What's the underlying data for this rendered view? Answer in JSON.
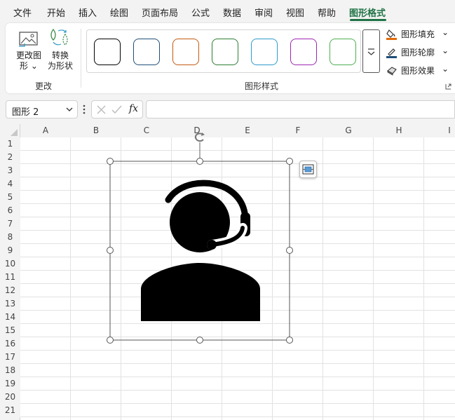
{
  "menu": {
    "items": [
      "文件",
      "开始",
      "插入",
      "绘图",
      "页面布局",
      "公式",
      "数据",
      "审阅",
      "视图",
      "帮助",
      "图形格式"
    ],
    "active_index": 10,
    "accent": "#217346"
  },
  "ribbon": {
    "change_group": {
      "label": "更改",
      "change_graphic_line1": "更改图",
      "change_graphic_line2": "形",
      "convert_line1": "转换",
      "convert_line2": "为形状"
    },
    "styles_group": {
      "label": "图形样式",
      "swatch_colors": [
        "#000000",
        "#1f4e79",
        "#c55a11",
        "#2e7d32",
        "#2e9bc8",
        "#9c27b0",
        "#4caf50"
      ],
      "fill_label": "图形填充",
      "outline_label": "图形轮廓",
      "effects_label": "图形效果",
      "fill_color": "#e26b0a",
      "outline_color": "#1f4e79"
    }
  },
  "formula_bar": {
    "name_box": "图形 2",
    "fx_label": "fx",
    "formula": ""
  },
  "sheet": {
    "columns": [
      "A",
      "B",
      "C",
      "D",
      "E",
      "F",
      "G",
      "H",
      "I"
    ],
    "rows": [
      "1",
      "2",
      "3",
      "4",
      "5",
      "6",
      "7",
      "8",
      "9",
      "10",
      "11",
      "12",
      "13",
      "14",
      "15",
      "16",
      "17",
      "18",
      "19",
      "20",
      "21"
    ]
  },
  "graphic": {
    "icon": "customer-service-headset-icon",
    "color": "#000000"
  }
}
